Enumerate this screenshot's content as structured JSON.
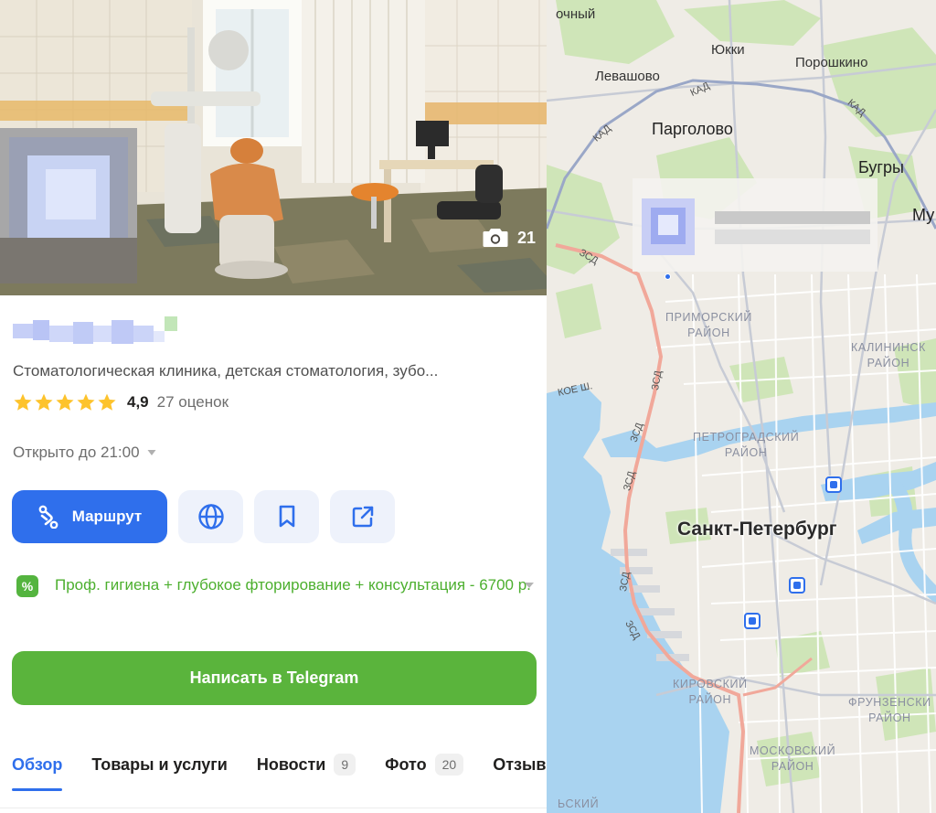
{
  "photo": {
    "count": "21",
    "alt": "Interior of dental clinic"
  },
  "org": {
    "category": "Стоматологическая клиника, детская стоматология, зубо...",
    "rating": "4,9",
    "rating_stars": 5,
    "reviews": "27 оценок",
    "hours": "Открыто до 21:00"
  },
  "actions": {
    "route_label": "Маршрут",
    "website_icon": "globe-icon",
    "bookmark_icon": "bookmark-icon",
    "share_icon": "share-icon"
  },
  "promo": {
    "badge": "%",
    "text": "Проф. гигиена + глубокое фторирование + консультация - 6700 р."
  },
  "telegram_button": "Написать в Telegram",
  "tabs": [
    {
      "label": "Обзор",
      "count": null,
      "active": true
    },
    {
      "label": "Товары и услуги",
      "count": null,
      "active": false
    },
    {
      "label": "Новости",
      "count": "9",
      "active": false
    },
    {
      "label": "Фото",
      "count": "20",
      "active": false
    },
    {
      "label": "Отзывы",
      "count": null,
      "active": false
    }
  ],
  "map": {
    "labels": {
      "zheleznodorozhny": "очный",
      "yukki": "Юкки",
      "levashovo": "Левашово",
      "poroshkino": "Порошкино",
      "pargolovo": "Парголово",
      "bugry": "Бугры",
      "murino": "Му",
      "primorsky": [
        "ПРИМОРСКИЙ",
        "РАЙОН"
      ],
      "kalininsky": [
        "КАЛИНИНСК",
        "РАЙОН"
      ],
      "petrogradsky": [
        "ПЕТРОГРАДСКИЙ",
        "РАЙОН"
      ],
      "kirovsky": [
        "КИРОВСКИЙ",
        "РАЙОН"
      ],
      "moskovsky": [
        "МОСКОВСКИЙ",
        "РАЙОН"
      ],
      "frunzensky": [
        "ФРУНЗЕНСКИ",
        "РАЙОН"
      ],
      "city": "Санкт-Петербург",
      "kad": "КАД",
      "zsd": "ЗСД",
      "shosse": "КОЕ Ш.",
      "bottom_district": "ЬСКИЙ"
    },
    "colors": {
      "land": "#efece6",
      "water": "#a8d2f0",
      "park": "#cde6b5",
      "road_major": "#f1a89a",
      "road_ring": "#9aa7c7",
      "road_minor": "#ffffff",
      "accent": "#2f6fec"
    }
  },
  "colors": {
    "primary": "#2f6fec",
    "green": "#5ab43c",
    "promo_green": "#4caf2e",
    "star": "#fdc32c"
  }
}
